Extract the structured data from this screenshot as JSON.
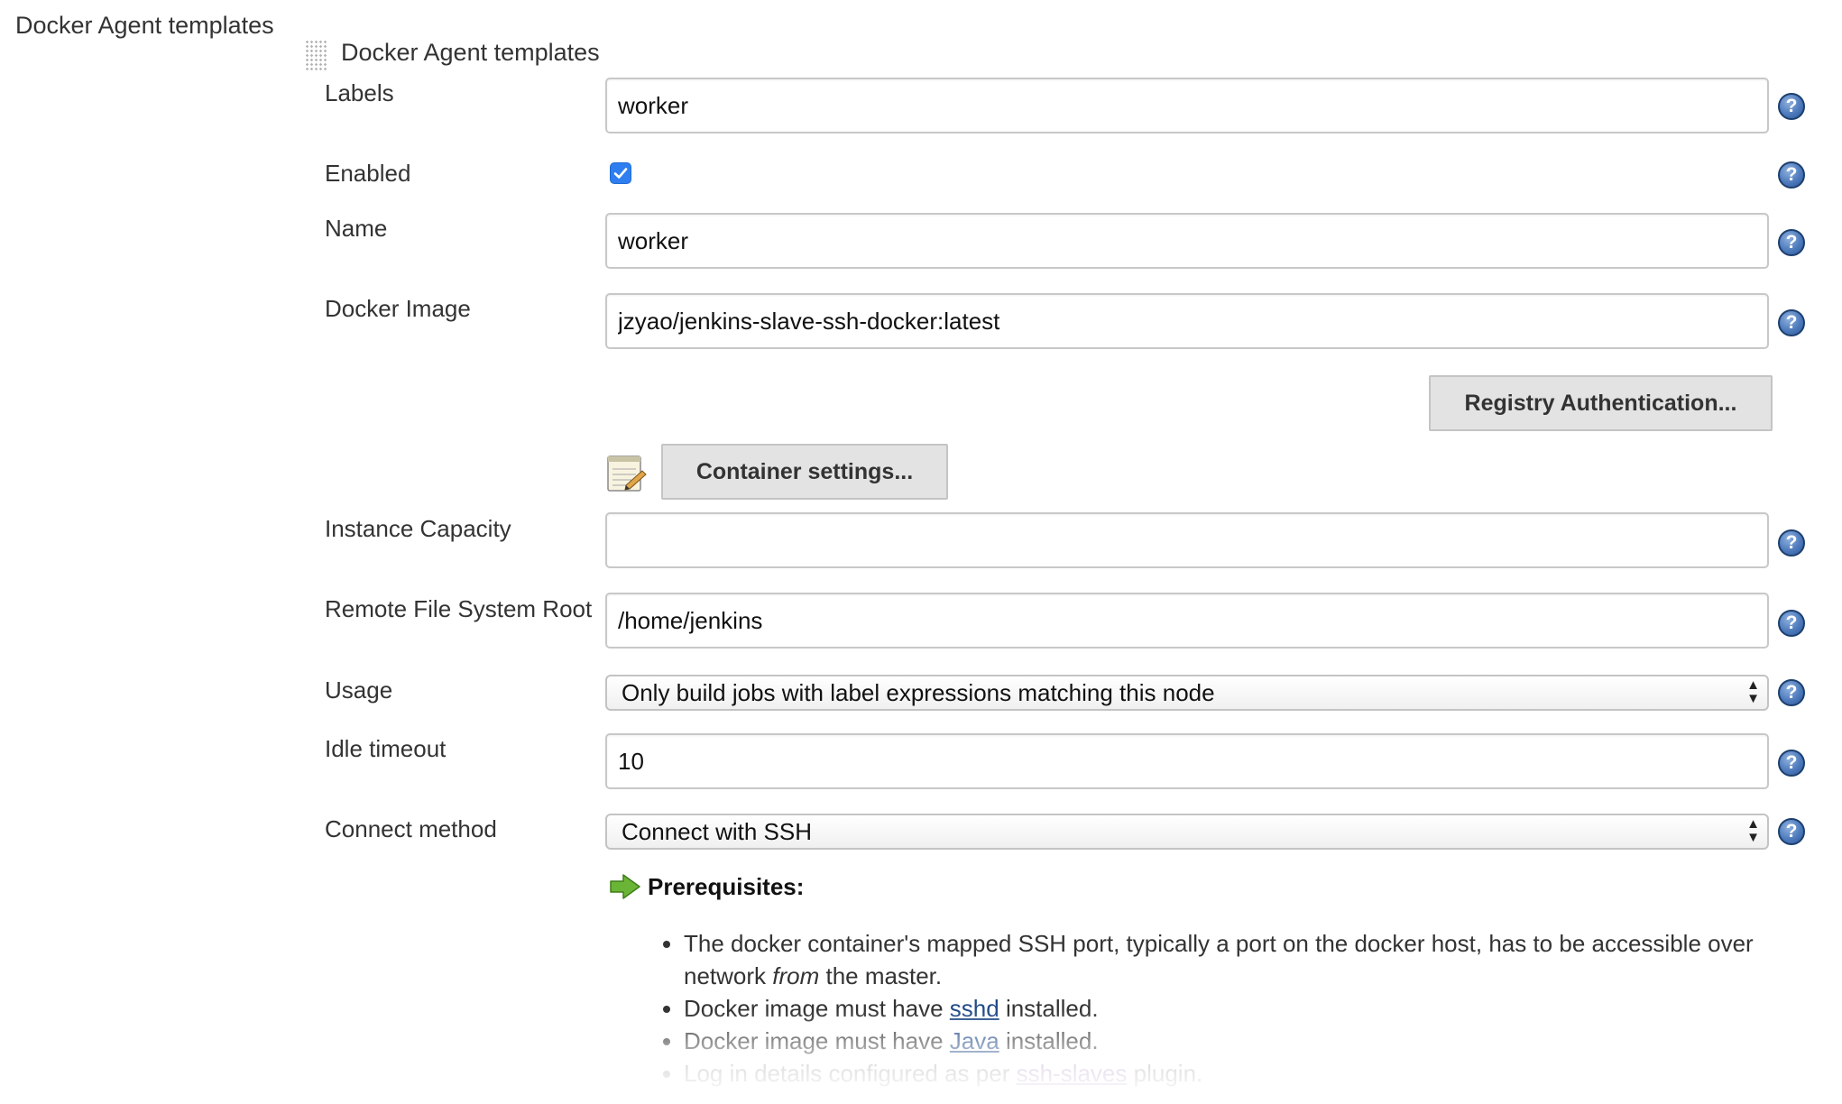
{
  "section": {
    "title": "Docker Agent templates"
  },
  "template_block": {
    "title": "Docker Agent templates"
  },
  "fields": {
    "labels": {
      "label": "Labels",
      "value": "worker"
    },
    "enabled": {
      "label": "Enabled",
      "checked": true
    },
    "name": {
      "label": "Name",
      "value": "worker"
    },
    "docker_image": {
      "label": "Docker Image",
      "value": "jzyao/jenkins-slave-ssh-docker:latest"
    },
    "instance_capacity": {
      "label": "Instance Capacity",
      "value": ""
    },
    "remote_fs_root": {
      "label": "Remote File System Root",
      "value": "/home/jenkins"
    },
    "usage": {
      "label": "Usage",
      "selected": "Only build jobs with label expressions matching this node"
    },
    "idle_timeout": {
      "label": "Idle timeout",
      "value": "10"
    },
    "connect_method": {
      "label": "Connect method",
      "selected": "Connect with SSH"
    }
  },
  "buttons": {
    "registry_auth": "Registry Authentication...",
    "container_settings": "Container settings..."
  },
  "help_icon": {
    "glyph": "?",
    "icon": "help-icon"
  },
  "prerequisites": {
    "title": "Prerequisites:",
    "item1_text": "The docker container's mapped SSH port, typically a port on the docker host, has to be accessible over network ",
    "item1_em": "from",
    "item1_tail": " the master.",
    "item2_pre": "Docker image must have ",
    "item2_link": "sshd",
    "item2_post": " installed.",
    "item3_pre": "Docker image must have ",
    "item3_link": "Java",
    "item3_post": " installed.",
    "item4_pre": "Log in details configured as per ",
    "item4_link": "ssh-slaves",
    "item4_post": " plugin."
  },
  "colors": {
    "checkbox": "#2e7ef0",
    "link": "#204a87",
    "help_icon": "#4e7bbd",
    "button_bg": "#e3e3e3"
  }
}
